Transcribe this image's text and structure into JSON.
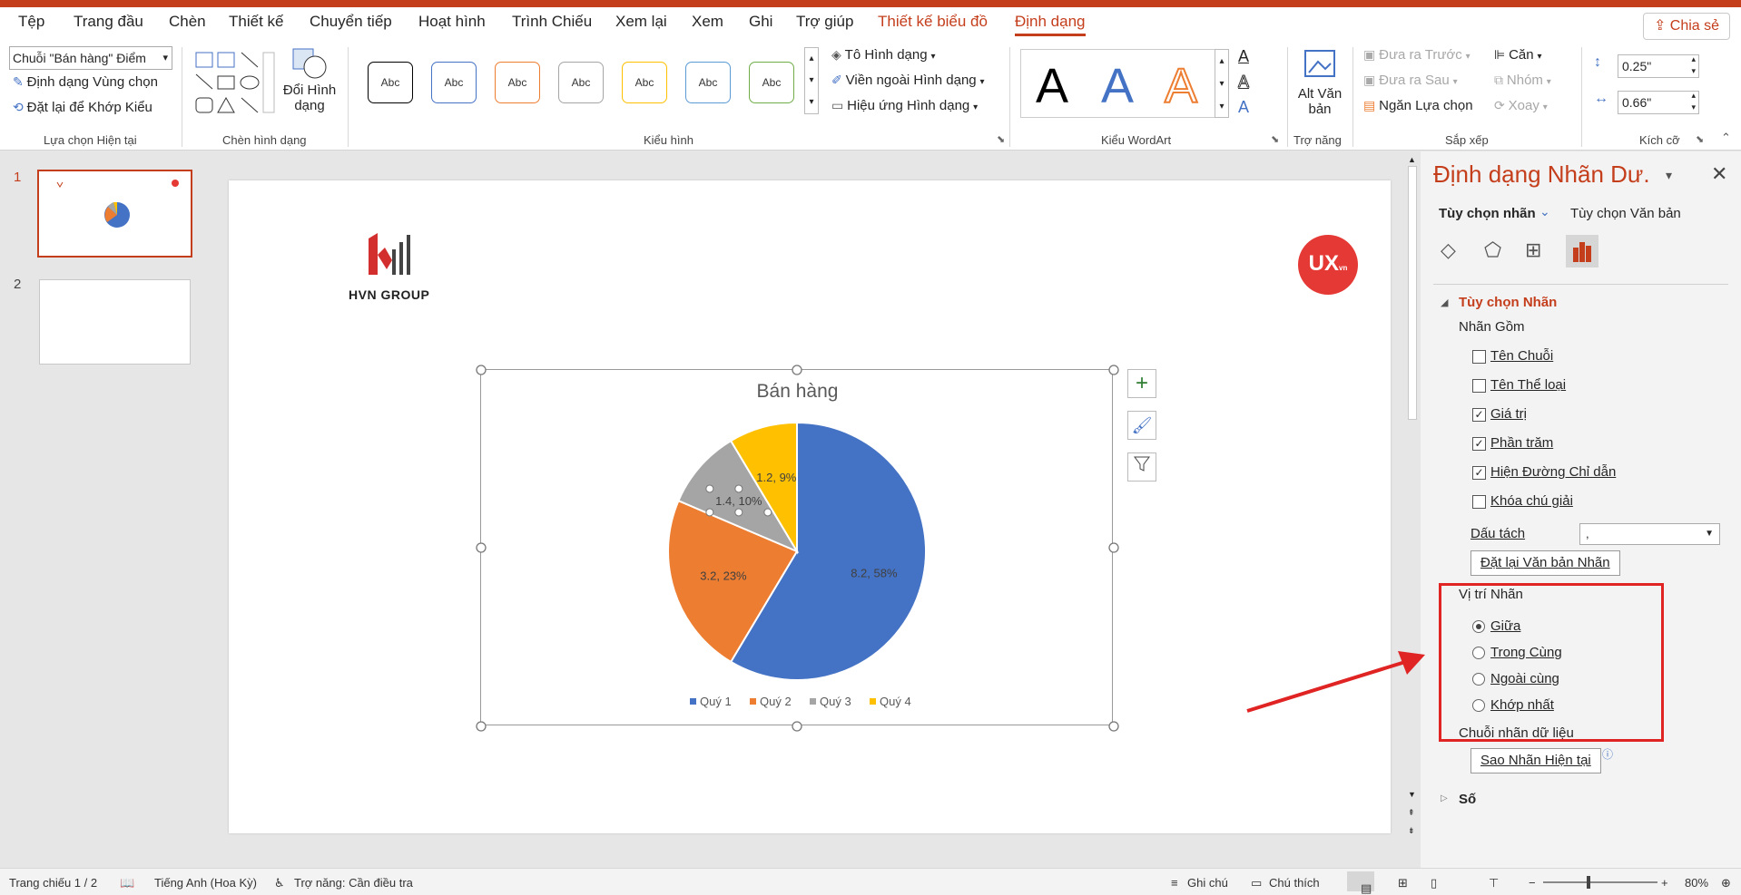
{
  "tabs": {
    "file": "Tệp",
    "home": "Trang đầu",
    "insert": "Chèn",
    "design": "Thiết kế",
    "transitions": "Chuyển tiếp",
    "animations": "Hoạt hình",
    "slideshow": "Trình Chiếu",
    "review": "Xem lại",
    "view": "Xem",
    "record": "Ghi",
    "help": "Trợ giúp",
    "chart_design": "Thiết kế biểu đồ",
    "format": "Định dạng",
    "share": "Chia sẻ"
  },
  "ribbon": {
    "current_selection": {
      "dropdown_value": "Chuỗi \"Bán hàng\" Điểm",
      "format_selection": "Định dạng Vùng chọn",
      "reset_to_match": "Đặt lại để Khớp Kiểu",
      "label": "Lựa chọn Hiện tại"
    },
    "insert_shapes": {
      "change_shape_line1": "Đổi Hình",
      "change_shape_line2": "dạng",
      "label": "Chèn hình dạng"
    },
    "shape_styles": {
      "swatch_text": "Abc",
      "swatch_colors": [
        "#000000",
        "#4472c4",
        "#ed7d31",
        "#a5a5a5",
        "#ffc000",
        "#5b9bd5",
        "#70ad47"
      ],
      "fill": "Tô Hình dạng",
      "outline": "Viền ngoài Hình dạng",
      "effects": "Hiệu ứng Hình dạng",
      "label": "Kiểu hình"
    },
    "wordart": {
      "letter": "A",
      "label": "Kiểu WordArt"
    },
    "accessibility": {
      "alt_line1": "Alt Văn",
      "alt_line2": "bản",
      "label": "Trợ năng"
    },
    "arrange": {
      "bring_forward": "Đưa ra Trước",
      "send_backward": "Đưa ra Sau",
      "selection_pane": "Ngăn Lựa chọn",
      "align": "Căn",
      "group": "Nhóm",
      "rotate": "Xoay",
      "label": "Sắp xếp"
    },
    "size": {
      "height": "0.25\"",
      "width": "0.66\"",
      "label": "Kích cỡ"
    }
  },
  "thumbnails": [
    "1",
    "2"
  ],
  "slide": {
    "logo_text": "HVN GROUP",
    "badge_text": "UX",
    "badge_sub": "vn",
    "chart_title": "Bán hàng"
  },
  "chart_data": {
    "type": "pie",
    "title": "Bán hàng",
    "categories": [
      "Quý 1",
      "Quý 2",
      "Quý 3",
      "Quý 4"
    ],
    "values": [
      8.2,
      3.2,
      1.4,
      1.2
    ],
    "data_labels": [
      "8.2, 58%",
      "3.2, 23%",
      "1.4, 10%",
      "1.2, 9%"
    ],
    "colors": [
      "#4472c4",
      "#ed7d31",
      "#a5a5a5",
      "#ffc000"
    ],
    "legend_position": "bottom"
  },
  "pane": {
    "title": "Định dạng Nhãn Dư.",
    "tab_label_options": "Tùy chọn nhãn",
    "tab_text_options": "Tùy chọn Văn bản",
    "section_label_options": "Tùy chọn Nhãn",
    "label_contains": "Nhãn Gồm",
    "checks": [
      {
        "label": "Tên Chuỗi",
        "checked": false
      },
      {
        "label": "Tên Thể loại",
        "checked": false
      },
      {
        "label": "Giá trị",
        "checked": true
      },
      {
        "label": "Phần trăm",
        "checked": true
      },
      {
        "label": "Hiện Đường Chỉ dẫn",
        "checked": true
      },
      {
        "label": "Khóa chú giải",
        "checked": false
      }
    ],
    "separator_label": "Dấu tách",
    "separator_value": ",",
    "reset_label_text": "Đặt lại Văn bản Nhãn",
    "label_position": "Vị trí Nhãn",
    "positions": [
      {
        "label": "Giữa",
        "selected": true
      },
      {
        "label": "Trong Cùng",
        "selected": false
      },
      {
        "label": "Ngoài cùng",
        "selected": false
      },
      {
        "label": "Khớp nhất",
        "selected": false
      }
    ],
    "data_label_series": "Chuỗi nhãn dữ liệu",
    "clone_label": "Sao Nhãn Hiện tại",
    "number_section": "Số"
  },
  "status": {
    "slide": "Trang chiếu 1 / 2",
    "language": "Tiếng Anh (Hoa Kỳ)",
    "accessibility": "Trợ năng: Cần điều tra",
    "notes": "Ghi chú",
    "comments": "Chú thích",
    "zoom": "80%"
  },
  "annotation_color": "#e02424"
}
